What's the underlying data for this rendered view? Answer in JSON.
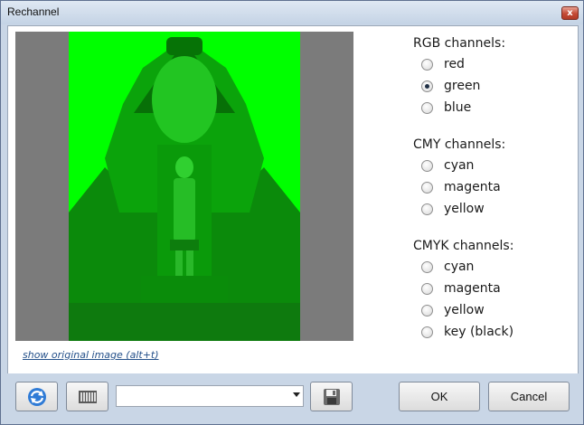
{
  "window": {
    "title": "Rechannel",
    "close_glyph": "x"
  },
  "preview": {
    "link_text": "show original image (alt+t)"
  },
  "groups": [
    {
      "title": "RGB channels:",
      "options": [
        {
          "label": "red",
          "checked": false
        },
        {
          "label": "green",
          "checked": true
        },
        {
          "label": "blue",
          "checked": false
        }
      ]
    },
    {
      "title": "CMY channels:",
      "options": [
        {
          "label": "cyan",
          "checked": false
        },
        {
          "label": "magenta",
          "checked": false
        },
        {
          "label": "yellow",
          "checked": false
        }
      ]
    },
    {
      "title": "CMYK channels:",
      "options": [
        {
          "label": "cyan",
          "checked": false
        },
        {
          "label": "magenta",
          "checked": false
        },
        {
          "label": "yellow",
          "checked": false
        },
        {
          "label": "key (black)",
          "checked": false
        }
      ]
    }
  ],
  "toolbar": {
    "refresh_icon": "refresh-icon",
    "batch_icon": "film-strip-icon",
    "save_icon": "save-icon",
    "preset_value": ""
  },
  "buttons": {
    "ok": "OK",
    "cancel": "Cancel"
  },
  "colors": {
    "channel_tint": "#00ff00",
    "preview_bg": "#7b7b7b"
  }
}
